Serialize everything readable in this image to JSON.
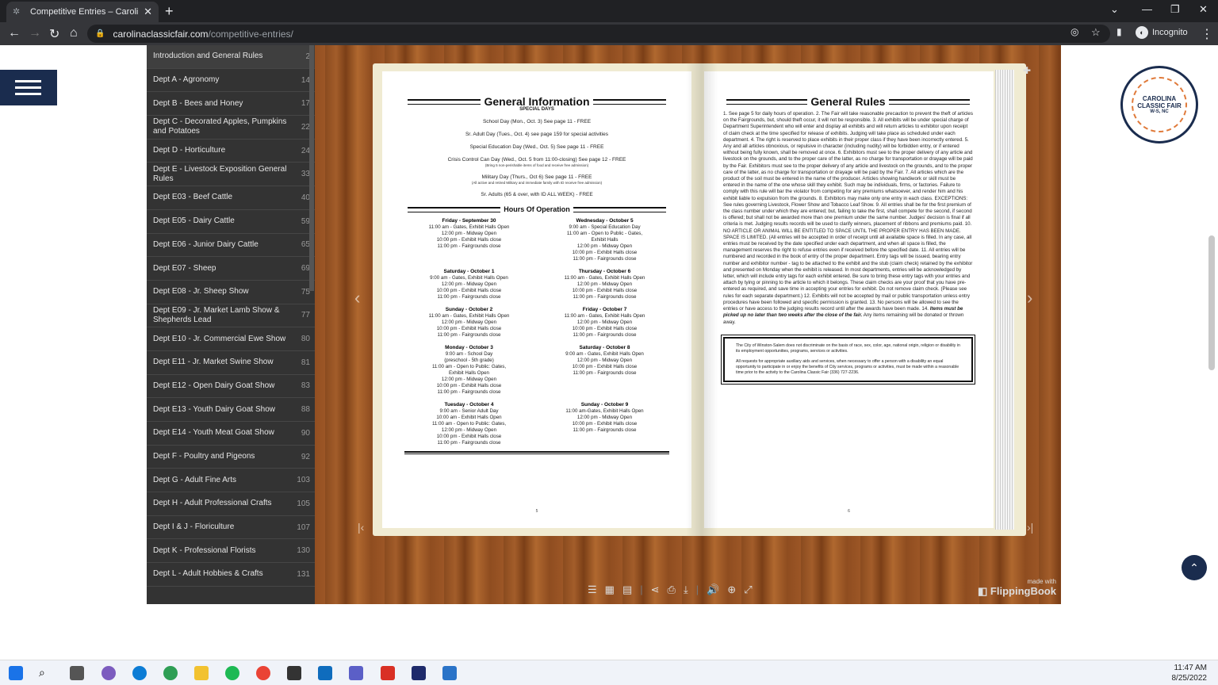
{
  "browser": {
    "tab_title": "Competitive Entries – Carolina Cl",
    "url_host": "carolinaclassicfair.com",
    "url_path": "/competitive-entries/",
    "profile": "Incognito"
  },
  "toc": {
    "items": [
      {
        "label": "Introduction and General Rules",
        "page": "2"
      },
      {
        "label": "Dept A - Agronomy",
        "page": "14"
      },
      {
        "label": "Dept B - Bees and Honey",
        "page": "17"
      },
      {
        "label": "Dept C - Decorated Apples, Pumpkins and Potatoes",
        "page": "22"
      },
      {
        "label": "Dept D - Horticulture",
        "page": "24"
      },
      {
        "label": "Dept E - Livestock Exposition General Rules",
        "page": "33"
      },
      {
        "label": "Dept E03 - Beef Cattle",
        "page": "40"
      },
      {
        "label": "Dept E05 - Dairy Cattle",
        "page": "59"
      },
      {
        "label": "Dept E06 - Junior Dairy Cattle",
        "page": "65"
      },
      {
        "label": "Dept E07 - Sheep",
        "page": "69"
      },
      {
        "label": "Dept E08 - Jr. Sheep Show",
        "page": "75"
      },
      {
        "label": "Dept E09 - Jr. Market Lamb Show & Shepherds Lead",
        "page": "77"
      },
      {
        "label": "Dept E10 - Jr. Commercial Ewe Show",
        "page": "80"
      },
      {
        "label": "Dept E11 - Jr. Market Swine Show",
        "page": "81"
      },
      {
        "label": "Dept E12 - Open Dairy Goat Show",
        "page": "83"
      },
      {
        "label": "Dept E13 - Youth Dairy Goat Show",
        "page": "88"
      },
      {
        "label": "Dept E14 - Youth Meat Goat Show",
        "page": "90"
      },
      {
        "label": "Dept F - Poultry and Pigeons",
        "page": "92"
      },
      {
        "label": "Dept G - Adult Fine Arts",
        "page": "103"
      },
      {
        "label": "Dept H - Adult Professional Crafts",
        "page": "105"
      },
      {
        "label": "Dept I & J - Floriculture",
        "page": "107"
      },
      {
        "label": "Dept K - Professional Florists",
        "page": "130"
      },
      {
        "label": "Dept L - Adult Hobbies & Crafts",
        "page": "131"
      }
    ]
  },
  "left_page": {
    "title": "General Information",
    "subtitle": "SPECIAL DAYS",
    "special_days": [
      {
        "text": "School Day (Mon., Oct. 3) See page 11 - FREE",
        "note": ""
      },
      {
        "text": "Sr. Adult Day (Tues., Oct. 4) see page 159 for special activities",
        "note": ""
      },
      {
        "text": "Special Education Day (Wed., Oct. 5) See page 11 - FREE",
        "note": ""
      },
      {
        "text": "Crisis Control Can Day (Wed., Oct. 5 from 11:00-closing) See page 12 - FREE",
        "note": "(Bring 5 non-perishable items of food and receive free admission)"
      },
      {
        "text": "Military Day (Thurs., Oct 6) See page 11 - FREE",
        "note": "(All active and retired Military and immediate family with ID receive free admission)"
      },
      {
        "text": "Sr. Adults (65 & over, with ID ALL WEEK) - FREE",
        "note": ""
      }
    ],
    "hours_title": "Hours Of Operation",
    "hours": [
      {
        "day": "Friday - September 30",
        "lines": [
          "11:00 am - Gates, Exhibit Halls Open",
          "12:00 pm - Midway Open",
          "10:00 pm - Exhibit Halls close",
          "11:00 pm - Fairgrounds close"
        ]
      },
      {
        "day": "Wednesday - October 5",
        "lines": [
          "9:00 am - Special Education Day",
          "11:00 am - Open to Public - Gates,",
          "Exhibit Halls",
          "12:00 pm - Midway Open",
          "10:00 pm - Exhibit Halls close",
          "11:00 pm - Fairgrounds close"
        ]
      },
      {
        "day": "Saturday - October 1",
        "lines": [
          "9:00 am - Gates, Exhibit Halls Open",
          "12:00 pm - Midway Open",
          "10:00 pm - Exhibit Halls close",
          "11:00 pm - Fairgrounds close"
        ]
      },
      {
        "day": "Thursday - October 6",
        "lines": [
          "11:00 am - Gates, Exhibit Halls Open",
          "12:00 pm - Midway Open",
          "10:00 pm - Exhibit Halls close",
          "11:00 pm - Fairgrounds close"
        ]
      },
      {
        "day": "Sunday - October 2",
        "lines": [
          "11:00 am - Gates, Exhibit Halls Open",
          "12:00 pm - Midway Open",
          "10:00 pm - Exhibit Halls close",
          "11:00 pm - Fairgrounds close"
        ]
      },
      {
        "day": "Friday - October 7",
        "lines": [
          "11:00 am - Gates, Exhibit Halls Open",
          "12:00 pm - Midway Open",
          "10:00 pm - Exhibit Halls close",
          "11:00 pm - Fairgrounds close"
        ]
      },
      {
        "day": "Monday - October 3",
        "lines": [
          "9:00 am - School Day",
          "(preschool - 5th grade)",
          "11:00 am - Open to Public: Gates,",
          "Exhibit Halls Open",
          "12:00 pm - Midway Open",
          "10:00 pm - Exhibit Halls close",
          "11:00 pm - Fairgrounds close"
        ]
      },
      {
        "day": "Saturday - October 8",
        "lines": [
          "9:00 am - Gates, Exhibit Halls Open",
          "12:00 pm - Midway Open",
          "10:00 pm - Exhibit Halls close",
          "11:00 pm - Fairgrounds close"
        ]
      },
      {
        "day": "Tuesday - October 4",
        "lines": [
          "9:00 am - Senior Adult Day",
          "10:00 am - Exhibit Halls Open",
          "11:00 am - Open to Public: Gates,",
          "12:00 pm - Midway Open",
          "10:00 pm - Exhibit Halls close",
          "11:00 pm - Fairgrounds close"
        ]
      },
      {
        "day": "Sunday - October 9",
        "lines": [
          "11:00 am-Gates, Exhibit Halls Open",
          "12:00 pm - Midway Open",
          "10:00 pm - Exhibit Halls close",
          "11:00 pm - Fairgrounds close"
        ]
      }
    ],
    "page_number": "5"
  },
  "right_page": {
    "title": "General Rules",
    "rules_text": "1. See page 5 for daily hours of operation. 2. The Fair will take reasonable precaution to prevent the theft of articles on the Fairgrounds, but, should theft occur, it will not be responsible. 3. All exhibits will be under special charge of Department Superintendent who will enter and display all exhibits and will return articles to exhibitor upon receipt of claim check at the time specified for release of exhibits. Judging will take place as scheduled under each department. 4. The right is reserved to place exhibits in their proper class if they have been incorrectly entered. 5. Any and all articles obnoxious, or repulsive in character (including nudity) will be forbidden entry, or if entered without being fully known, shall be removed at once. 6. Exhibitors must see to the proper delivery of any article and livestock on the grounds, and to the proper care of the latter, as no charge for transportation or drayage will be paid by the Fair. Exhibitors must see to the proper delivery of any article and livestock on the grounds, and to the proper care of the latter, as no charge for transportation or drayage will be paid by the Fair. 7. All articles which are the product of the soil must be entered in the name of the producer. Articles showing handiwork or skill must be entered in the name of the one whose skill they exhibit. Such may be individuals, firms, or factories. Failure to comply with this rule will bar the violator from competing for any premiums whatsoever, and render him and his exhibit liable to expulsion from the grounds. 8. Exhibitors may make only one entry in each class. EXCEPTIONS: See rules governing Livestock, Flower Show and Tobacco Leaf Show. 9. All entries shall be for the first premium of the class number under which they are entered; but, failing to take the first, shall compete for the second, if second is offered; but shall not be awarded more than one premium under the same number. Judges' decision is final if all criteria is met. Judging results records will be used to clarify winners, placement of ribbons and premiums paid. 10. NO ARTICLE OR ANIMAL WILL BE ENTITLED TO SPACE UNTIL THE PROPER ENTRY HAS BEEN MADE. SPACE IS LIMITED. (All entries will be accepted in order of receipt until all available space is filled. In any case, all entries must be received by the date specified under each department, and when all space is filled, the management reserves the right to refuse entries even if received before the specified date. 11. All entries will be numbered and recorded in the book of entry of the proper department. Entry tags will be issued, bearing entry number and exhibitor number - tag to be attached to the exhibit and the stub (claim check) retained by the exhibitor and presented on Monday when the exhibit is released. In most departments, entries will be acknowledged by letter, which will include entry tags for each exhibit entered. Be sure to bring these entry tags with your entries and attach by tying or pinning to the article to which it belongs. These claim checks are your proof that you have pre-entered as required, and save time in accepting your entries for exhibit. Do not remove claim check. (Please see rules for each separate department.) 12. Exhibits will not be accepted by mail or public transportation unless entry procedures have been followed and specific permission is granted. 13. No persons will be allowed to see the entries or have access to the judging results record until after the awards have been made.",
    "rule14_prefix": "14. ",
    "rule14_emph": "Items must be picked up no later than two weeks after the close of the fair.",
    "rule14_rest": " Any items remaining will be donated or thrown away.",
    "notice_1": "The City of Winston-Salem does not discriminate on the basis of race, sex, color, age, national origin, religion or disability in its employment opportunities, programs, services or activities.",
    "notice_2": "All requests for appropriate auxiliary aids and services, when necessary to offer a person with a disability an equal opportunity to participate in or enjoy the benefits of City services, programs or activities, must be made within a reasonable time prior to the activity to the Carolina Classic Fair (336) 727-2236.",
    "page_number": "6"
  },
  "viewer": {
    "made_with": "made with",
    "brand": "FlippingBook"
  },
  "logo": {
    "line1": "CAROLINA",
    "line2": "CLASSIC FAIR",
    "line3": "W-S, NC"
  },
  "taskbar": {
    "time": "11:47 AM",
    "date": "8/25/2022"
  }
}
